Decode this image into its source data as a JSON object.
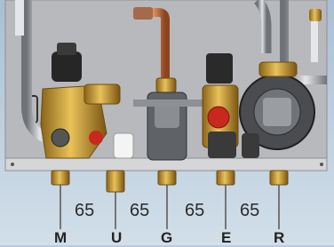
{
  "diagram": {
    "colors": {
      "background": "#b9cbdc",
      "panel": "#b7b9bc",
      "brass": "#c79a2e",
      "copper": "#c86f3a",
      "steel": "#9a9ea3",
      "dark": "#2d2d2d",
      "red": "#c8281e",
      "dimension_line": "#555555"
    },
    "spacing_labels": [
      "65",
      "65",
      "65",
      "65"
    ],
    "connections": [
      {
        "letter": "M"
      },
      {
        "letter": "U"
      },
      {
        "letter": "G"
      },
      {
        "letter": "E"
      },
      {
        "letter": "R"
      }
    ],
    "icons": [
      "pipe",
      "valve",
      "pump",
      "pressure-gauge",
      "fitting"
    ]
  }
}
